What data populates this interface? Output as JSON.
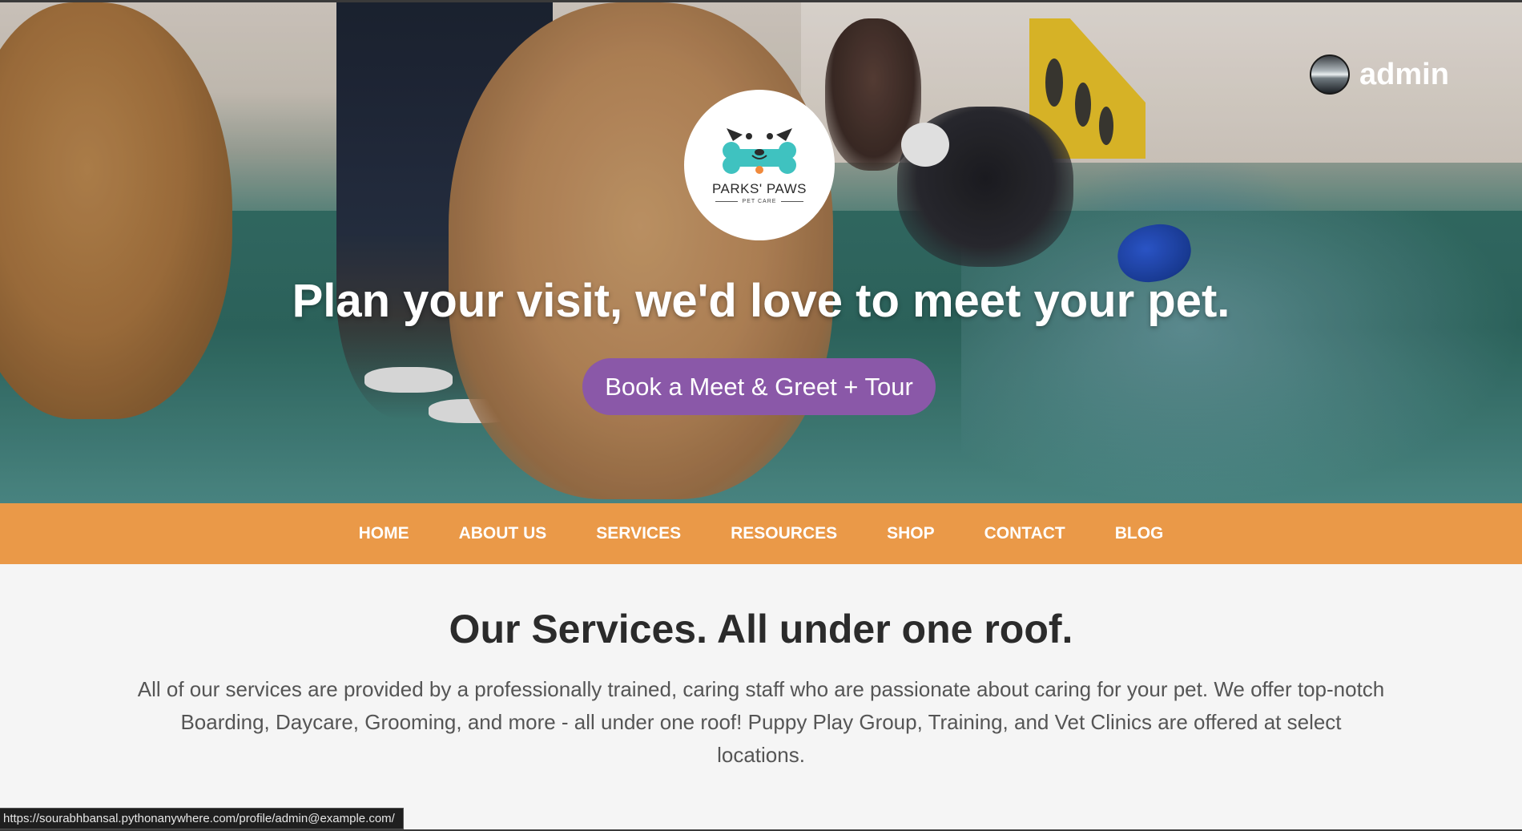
{
  "brand": {
    "logo_name": "PARKS' PAWS",
    "logo_sub": "PET CARE"
  },
  "user": {
    "name": "admin"
  },
  "hero": {
    "title": "Plan your visit, we'd love to meet your pet.",
    "cta_label": "Book a Meet & Greet + Tour"
  },
  "nav": {
    "items": [
      "HOME",
      "ABOUT US",
      "SERVICES",
      "RESOURCES",
      "SHOP",
      "CONTACT",
      "BLOG"
    ]
  },
  "services": {
    "title": "Our Services. All under one roof.",
    "description": "All of our services are provided by a professionally trained, caring staff who are passionate about caring for your pet. We offer top-notch Boarding, Daycare, Grooming, and more - all under one roof! Puppy Play Group, Training, and Vet Clinics are offered at select locations."
  },
  "status_bar": {
    "url": "https://sourabhbansal.pythonanywhere.com/profile/admin@example.com/"
  },
  "colors": {
    "nav_bg": "#ea9948",
    "cta_bg": "#8a58a8",
    "logo_teal": "#3fc2c0",
    "content_bg": "#f5f5f5"
  }
}
